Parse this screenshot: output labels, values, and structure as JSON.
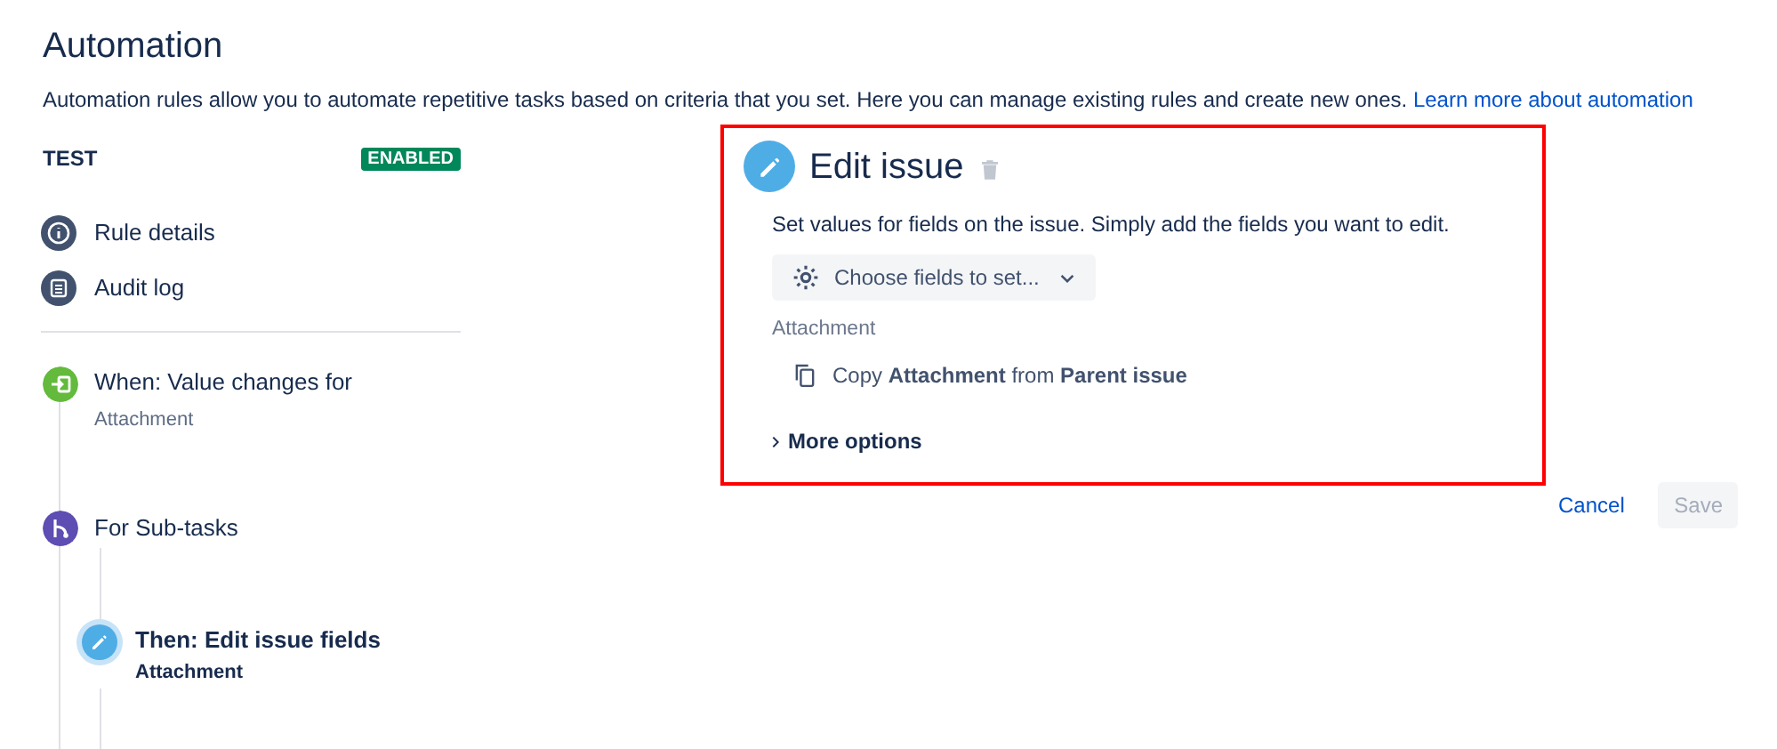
{
  "page": {
    "title": "Automation",
    "description": "Automation rules allow you to automate repetitive tasks based on criteria that you set. Here you can manage existing rules and create new ones.",
    "learn_more_link": "Learn more about automation"
  },
  "rule": {
    "name": "TEST",
    "status": "ENABLED"
  },
  "nav": [
    {
      "kind": "info",
      "label": "Rule details"
    },
    {
      "kind": "log",
      "label": "Audit log"
    }
  ],
  "steps": [
    {
      "kind": "trigger",
      "title": "When: Value changes for",
      "subtitle": "Attachment",
      "selected": false
    },
    {
      "kind": "branch",
      "title": "For Sub-tasks",
      "selected": false,
      "children": [
        {
          "kind": "action",
          "title": "Then: Edit issue fields",
          "subtitle": "Attachment",
          "selected": true
        }
      ]
    }
  ],
  "panel": {
    "title": "Edit issue",
    "description": "Set values for fields on the issue. Simply add the fields you want to edit.",
    "choose_button": "Choose fields to set...",
    "field_label": "Attachment",
    "field_value": "Copy **Attachment** from **Parent issue**",
    "more_options": "More options",
    "more_options_expanded": false
  },
  "buttons": {
    "cancel": "Cancel",
    "save": "Save",
    "save_disabled": true
  }
}
